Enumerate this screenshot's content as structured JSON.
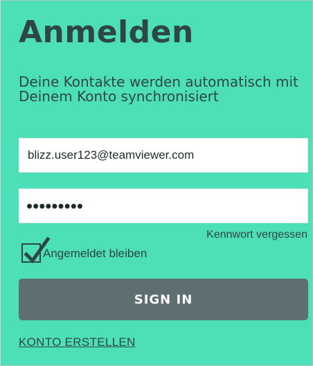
{
  "login": {
    "title": "Anmelden",
    "subtitle": "Deine Kontakte werden automatisch mit Deinem Konto synchronisiert",
    "email_value": "blizz.user123@teamviewer.com",
    "password_value": "•••••••••",
    "forgot_password_label": "Kennwort vergessen",
    "remember_label": "Angemeldet bleiben",
    "remember_checked": true,
    "sign_in_label": "SIGN IN",
    "create_account_label": "KONTO ERSTELLEN"
  },
  "colors": {
    "background": "#4ddfb7",
    "text": "#2f4744",
    "button": "#5d6f71",
    "button_text": "#ffffff",
    "field": "#ffffff"
  },
  "icons": {
    "remember_check": "checkmark-icon"
  }
}
